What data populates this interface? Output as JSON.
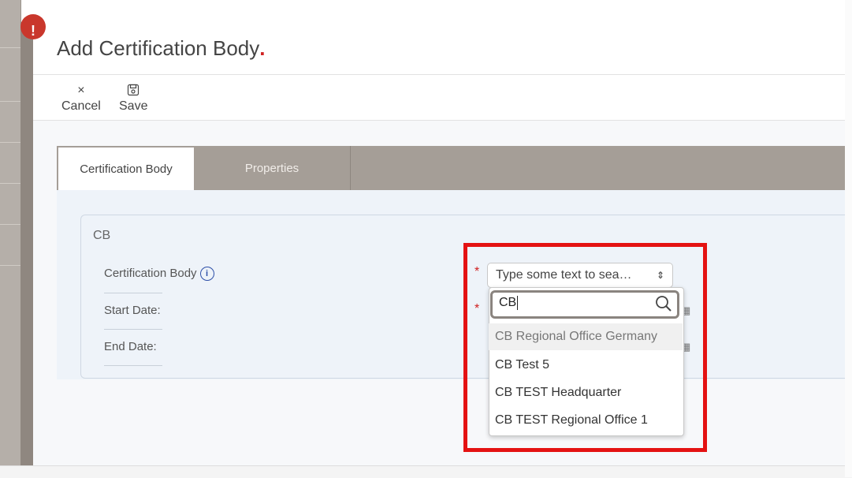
{
  "page": {
    "title": "Add Certification Body",
    "title_dot": "."
  },
  "toolbar": {
    "cancel_label": "Cancel",
    "cancel_icon": "×",
    "save_label": "Save",
    "save_icon": "save-icon"
  },
  "tabs": [
    {
      "label": "Certification Body",
      "active": true
    },
    {
      "label": "Properties",
      "active": false
    }
  ],
  "fieldset": {
    "legend": "CB",
    "fields": [
      {
        "label": "Certification Body"
      },
      {
        "label": "Start Date:"
      },
      {
        "label": "End Date:"
      }
    ],
    "required_mark": "*"
  },
  "select": {
    "placeholder": "Type some text to sea…",
    "search_value": "CB",
    "options": [
      "CB Regional Office Germany",
      "CB Test 5",
      "CB TEST Headquarter",
      "CB TEST Regional Office 1"
    ],
    "highlighted_index": 0
  },
  "badge": "!",
  "colors": {
    "accent_red": "#e41212",
    "tab_bar": "#a59e97",
    "panel_bg": "#eef3f9"
  }
}
